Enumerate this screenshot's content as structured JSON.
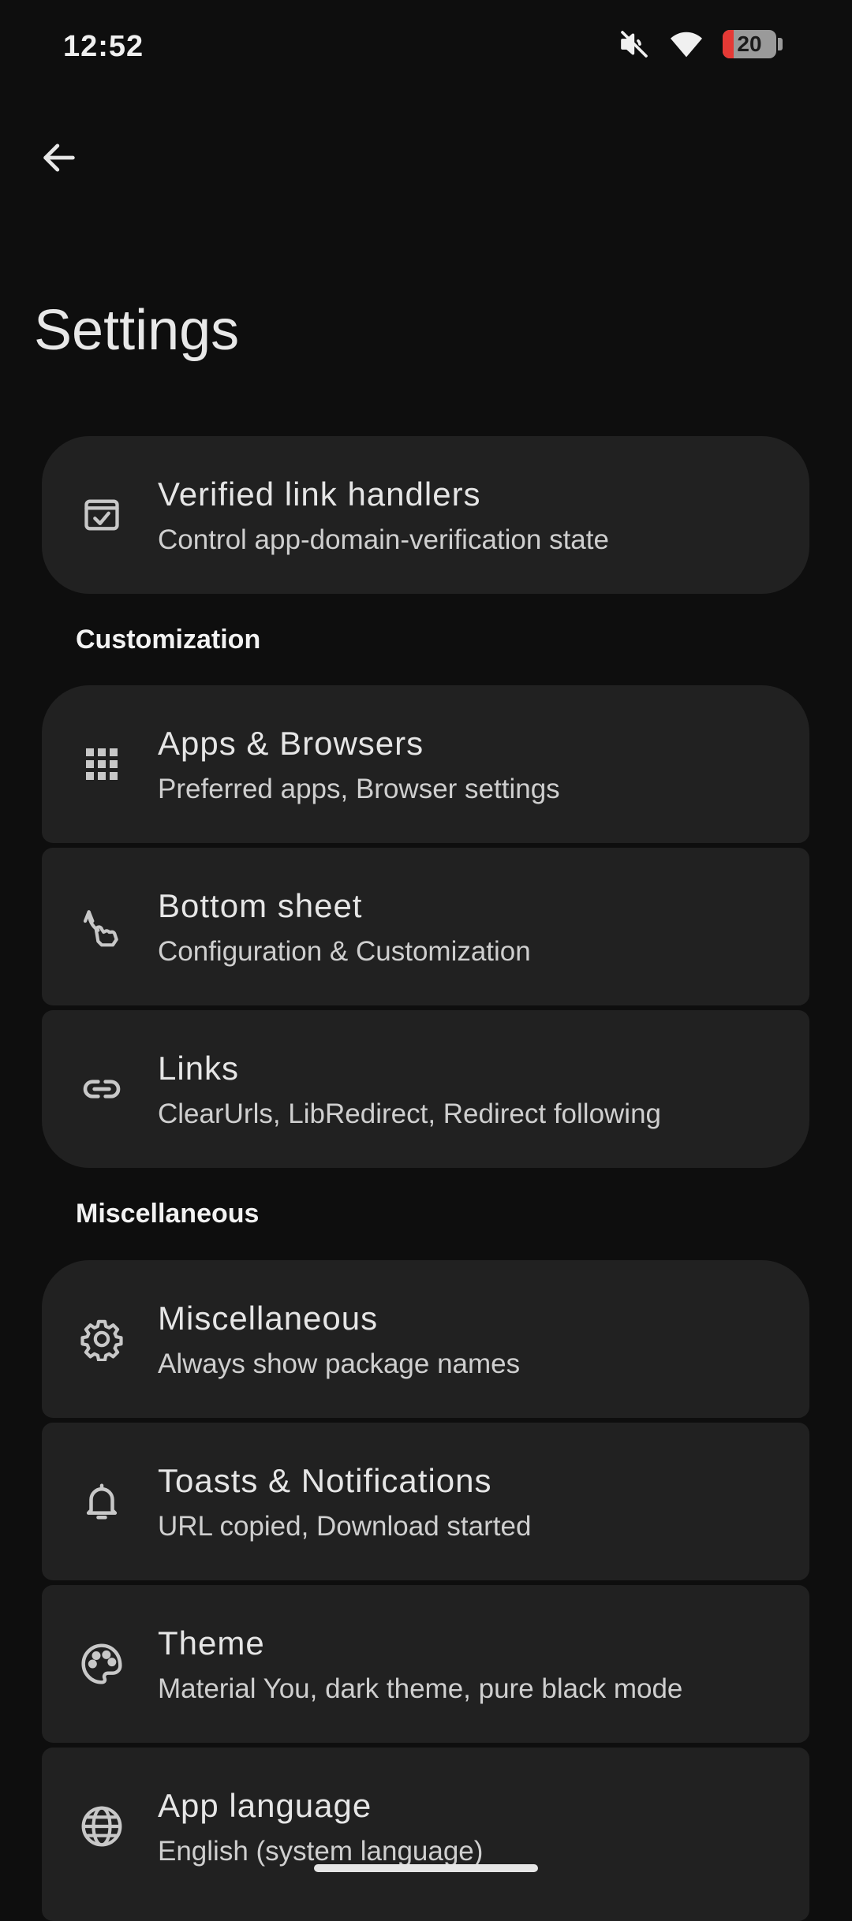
{
  "status_bar": {
    "time": "12:52",
    "battery_level": "20",
    "icons": [
      "mute-icon",
      "wifi-icon",
      "battery-icon"
    ]
  },
  "header": {
    "back_icon": "arrow-back-icon",
    "title": "Settings"
  },
  "colors": {
    "background": "#0e0e0e",
    "card": "#212121",
    "battery_low": "#e53935"
  },
  "items": [
    {
      "icon": "verified-checkbox-icon",
      "title": "Verified link handlers",
      "subtitle": "Control app-domain-verification state"
    },
    {
      "icon": "apps-grid-icon",
      "title": "Apps & Browsers",
      "subtitle": "Preferred apps, Browser settings"
    },
    {
      "icon": "swipe-gesture-icon",
      "title": "Bottom sheet",
      "subtitle": "Configuration & Customization"
    },
    {
      "icon": "link-icon",
      "title": "Links",
      "subtitle": "ClearUrls, LibRedirect, Redirect following"
    },
    {
      "icon": "gear-icon",
      "title": "Miscellaneous",
      "subtitle": "Always show package names"
    },
    {
      "icon": "bell-icon",
      "title": "Toasts & Notifications",
      "subtitle": "URL copied, Download started"
    },
    {
      "icon": "palette-icon",
      "title": "Theme",
      "subtitle": "Material You, dark theme, pure black mode"
    },
    {
      "icon": "globe-icon",
      "title": "App language",
      "subtitle": "English (system language)"
    }
  ],
  "sections": [
    {
      "label": "Customization"
    },
    {
      "label": "Miscellaneous"
    }
  ]
}
